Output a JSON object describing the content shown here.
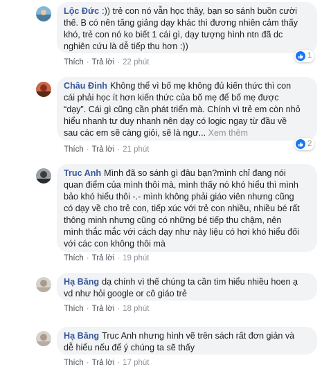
{
  "colors": {
    "author": "#385898",
    "text": "#1c1e21",
    "bubble": "#f2f3f5",
    "meta": "#90949c",
    "like_blue": "#1877f2"
  },
  "actions": {
    "like": "Thích",
    "reply": "Trả lời",
    "sep": "·"
  },
  "comments": [
    {
      "author": "Lộc Đức",
      "lines": [
        ":)) trẻ con nó vẫn học thây, bạn so sánh buồn cười",
        "thế. B có nên tăng giảng dạy khác thì đương nhiên cảm thấy",
        "khó, trẻ con nó ko biết 1 cái gì, dạy tượng hình ntn đã dc",
        "nghiên cứu là dễ tiếp thu hơn :))"
      ],
      "time": "22 phút",
      "reactions": "1"
    },
    {
      "author": "Châu Đinh",
      "lines": [
        "Không thể vì bố mẹ không đủ kiến thức thì con",
        "cái phải học ít hơn kiến thức của bố mẹ để bố mẹ được",
        "“dạy”. Cái gì cũng cần phát triển mà. Chính vì trẻ em còn nhỏ",
        "hiểu nhanh tư duy nhanh nên dạy có logic ngay từ đầu về",
        "sau các em sẽ càng giỏi, sẽ là ngư..."
      ],
      "see_more": "Xem thêm",
      "time": "21 phút",
      "reactions": "2"
    },
    {
      "author": "Truc Anh",
      "lines": [
        "Mình đã so sánh gì đâu bạn?mình chỉ đang nói",
        "quan điểm của mình thôi mà, mình thấy nó khó hiểu thì mình",
        "bảo khó hiểu thôi -.- mình không phải giáo viên nhưng cũng",
        "có dạy về cho trẻ con, tiếp xúc với trẻ con nhiều, nhiều bé rất",
        "thông minh nhưng cũng có những bé tiếp thu chậm, nên",
        "mình thắc mắc với cách dạy như này liệu có hơi khó hiểu đối",
        "với các con không thôi mà"
      ],
      "time": "19 phút"
    },
    {
      "author": "Hạ Băng",
      "lines": [
        "dạ chính vì thế chúng ta cần tìm hiểu nhiều hoen ạ",
        "vd như hỏi google or cô giáo trẻ"
      ],
      "time": "18 phút"
    },
    {
      "author": "Hạ Băng",
      "lines": [
        "Truc Anh nhưng hình vẽ trên sách rất đơn giản và",
        "dễ hiểu nếu để ý chúng ta sẽ thấy"
      ],
      "time": "17 phút"
    }
  ]
}
